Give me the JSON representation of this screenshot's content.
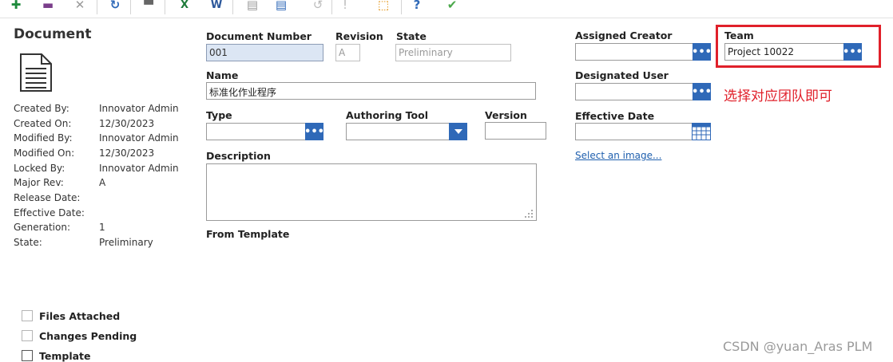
{
  "toolbar": {
    "items": [
      {
        "name": "new-icon",
        "glyph": "✚",
        "color": "#1e8a3c"
      },
      {
        "name": "save-icon",
        "glyph": "▬",
        "color": "#7a3d8a"
      },
      {
        "name": "delete-icon",
        "glyph": "✕",
        "color": "#9a9a9a"
      },
      {
        "name": "refresh-icon",
        "glyph": "↻",
        "color": "#2f69b8"
      },
      {
        "name": "print-icon",
        "glyph": "▀",
        "color": "#666666"
      },
      {
        "name": "excel-icon",
        "glyph": "X",
        "color": "#1e7b3a"
      },
      {
        "name": "word-icon",
        "glyph": "W",
        "color": "#2b579a"
      },
      {
        "name": "document-view-icon",
        "glyph": "▤",
        "color": "#9a9a9a"
      },
      {
        "name": "form-view-icon",
        "glyph": "▤",
        "color": "#2f69b8"
      },
      {
        "name": "undo-icon",
        "glyph": "↺",
        "color": "#bbbbbb"
      },
      {
        "name": "lock-icon",
        "glyph": "!",
        "color": "#bbbbbb"
      },
      {
        "name": "export-icon",
        "glyph": "⬚",
        "color": "#e08a00"
      },
      {
        "name": "help-icon",
        "glyph": "?",
        "color": "#2f69b8"
      },
      {
        "name": "done-icon",
        "glyph": "✔",
        "color": "#4aa84a"
      }
    ]
  },
  "doc": {
    "title": "Document",
    "meta": [
      {
        "label": "Created By:",
        "value": "Innovator Admin"
      },
      {
        "label": "Created On:",
        "value": "12/30/2023"
      },
      {
        "label": "Modified By:",
        "value": "Innovator Admin"
      },
      {
        "label": "Modified On:",
        "value": "12/30/2023"
      },
      {
        "label": "Locked By:",
        "value": "Innovator Admin"
      },
      {
        "label": "Major Rev:",
        "value": "A"
      },
      {
        "label": "Release Date:",
        "value": ""
      },
      {
        "label": "Effective Date:",
        "value": ""
      },
      {
        "label": "Generation:",
        "value": "1"
      },
      {
        "label": "State:",
        "value": "Preliminary"
      }
    ]
  },
  "fields": {
    "document_number": {
      "label": "Document Number",
      "value": "001"
    },
    "revision": {
      "label": "Revision",
      "value": "A"
    },
    "state": {
      "label": "State",
      "value": "Preliminary"
    },
    "name": {
      "label": "Name",
      "value": "标准化作业程序"
    },
    "type": {
      "label": "Type",
      "value": ""
    },
    "authoring_tool": {
      "label": "Authoring Tool",
      "value": ""
    },
    "version": {
      "label": "Version",
      "value": ""
    },
    "description": {
      "label": "Description",
      "value": ""
    },
    "from_template": {
      "label": "From Template"
    },
    "assigned_creator": {
      "label": "Assigned Creator",
      "value": ""
    },
    "team": {
      "label": "Team",
      "value": "Project 10022"
    },
    "designated_user": {
      "label": "Designated User",
      "value": ""
    },
    "effective_date": {
      "label": "Effective Date",
      "value": ""
    },
    "select_image": {
      "label": "Select an image..."
    },
    "ellipsis": "•••"
  },
  "checkboxes": [
    {
      "label": "Files Attached",
      "checked": false
    },
    {
      "label": "Changes Pending",
      "checked": false
    },
    {
      "label": "Template",
      "checked": false
    }
  ],
  "annotation": "选择对应团队即可",
  "watermark": "CSDN @yuan_Aras PLM",
  "colors": {
    "accent": "#2f69b8",
    "highlight": "#e0202a"
  }
}
